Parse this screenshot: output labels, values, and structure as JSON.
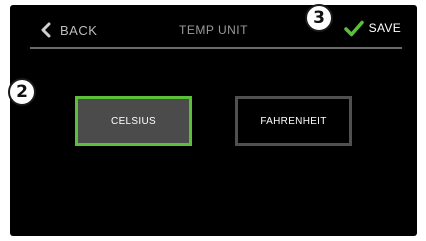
{
  "header": {
    "back_label": "BACK",
    "title": "TEMP UNIT",
    "save_label": "SAVE",
    "back_icon": "chevron-left-icon",
    "save_icon": "check-icon"
  },
  "options": [
    {
      "label": "CELSIUS",
      "selected": true
    },
    {
      "label": "FAHRENHEIT",
      "selected": false
    }
  ],
  "callouts": [
    {
      "label": "2"
    },
    {
      "label": "3"
    }
  ],
  "colors": {
    "accent_green": "#5bbf3a",
    "screen_bg": "#000000",
    "selected_fill": "#4b4b4b",
    "unselected_border": "#505050"
  }
}
